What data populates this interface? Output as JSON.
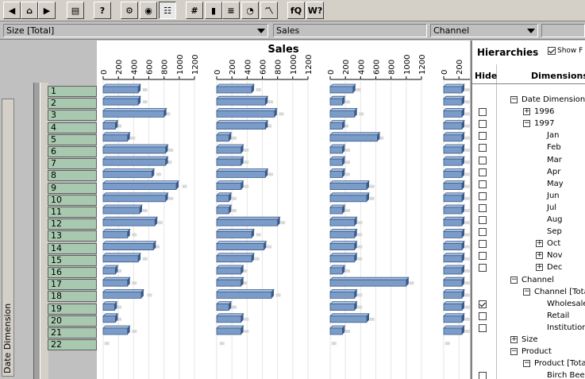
{
  "toolbar": {
    "buttons": [
      {
        "name": "back-arrow-icon",
        "glyph": "◀"
      },
      {
        "name": "home-icon",
        "glyph": "⌂"
      },
      {
        "name": "forward-arrow-icon",
        "glyph": "▶"
      },
      {
        "name": "report-icon",
        "glyph": "▤"
      },
      {
        "name": "query-icon",
        "glyph": "?"
      },
      {
        "name": "chart-wizard-icon",
        "glyph": "⚙"
      },
      {
        "name": "palette-icon",
        "glyph": "◉"
      },
      {
        "name": "hierarchy-icon",
        "glyph": "☷"
      },
      {
        "name": "number-format-icon",
        "glyph": "#"
      },
      {
        "name": "vertical-bar-chart-icon",
        "glyph": "▮"
      },
      {
        "name": "horizontal-bar-chart-icon",
        "glyph": "≡"
      },
      {
        "name": "pie-chart-icon",
        "glyph": "◔"
      },
      {
        "name": "line-chart-icon",
        "glyph": "〽"
      },
      {
        "name": "formula-icon",
        "glyph": "fQ"
      },
      {
        "name": "help-icon",
        "glyph": "W?"
      }
    ]
  },
  "dropdowns": {
    "size": "Size [Total]",
    "measure": "Sales",
    "channel": "Channel"
  },
  "row_dimension": "Date Dimension",
  "row_labels": [
    "1",
    "2",
    "3",
    "4",
    "5",
    "6",
    "7",
    "8",
    "9",
    "10",
    "11",
    "12",
    "13",
    "14",
    "15",
    "16",
    "17",
    "18",
    "19",
    "20",
    "21",
    "22"
  ],
  "hierarchies": {
    "title": "Hierarchies",
    "show_label": "Show F",
    "show_checked": true,
    "col_hide": "Hide",
    "col_dimensions": "Dimensions",
    "items": [
      {
        "label": "Date Dimension",
        "toggle": "−",
        "level": 0,
        "checkbox": false
      },
      {
        "label": "1996",
        "toggle": "+",
        "level": 1,
        "checkbox": true,
        "checked": false
      },
      {
        "label": "1997",
        "toggle": "−",
        "level": 1,
        "checkbox": true,
        "checked": false
      },
      {
        "label": "Jan",
        "toggle": "",
        "level": 2,
        "checkbox": true,
        "checked": false
      },
      {
        "label": "Feb",
        "toggle": "",
        "level": 2,
        "checkbox": true,
        "checked": false
      },
      {
        "label": "Mar",
        "toggle": "",
        "level": 2,
        "checkbox": true,
        "checked": false
      },
      {
        "label": "Apr",
        "toggle": "",
        "level": 2,
        "checkbox": true,
        "checked": false
      },
      {
        "label": "May",
        "toggle": "",
        "level": 2,
        "checkbox": true,
        "checked": false
      },
      {
        "label": "Jun",
        "toggle": "",
        "level": 2,
        "checkbox": true,
        "checked": false
      },
      {
        "label": "Jul",
        "toggle": "",
        "level": 2,
        "checkbox": true,
        "checked": false
      },
      {
        "label": "Aug",
        "toggle": "",
        "level": 2,
        "checkbox": true,
        "checked": false
      },
      {
        "label": "Sep",
        "toggle": "",
        "level": 2,
        "checkbox": true,
        "checked": false
      },
      {
        "label": "Oct",
        "toggle": "+",
        "level": 2,
        "checkbox": true,
        "checked": false
      },
      {
        "label": "Nov",
        "toggle": "+",
        "level": 2,
        "checkbox": true,
        "checked": false
      },
      {
        "label": "Dec",
        "toggle": "+",
        "level": 2,
        "checkbox": true,
        "checked": false
      },
      {
        "label": "Channel",
        "toggle": "−",
        "level": 0,
        "checkbox": false
      },
      {
        "label": "Channel [Tota",
        "toggle": "−",
        "level": 1,
        "checkbox": false
      },
      {
        "label": "Wholesale",
        "toggle": "",
        "level": 2,
        "checkbox": true,
        "checked": true
      },
      {
        "label": "Retail",
        "toggle": "",
        "level": 2,
        "checkbox": true,
        "checked": false
      },
      {
        "label": "Institution",
        "toggle": "",
        "level": 2,
        "checkbox": true,
        "checked": false
      },
      {
        "label": "Size",
        "toggle": "+",
        "level": 0,
        "checkbox": false
      },
      {
        "label": "Product",
        "toggle": "−",
        "level": 0,
        "checkbox": false
      },
      {
        "label": "Product [Tota",
        "toggle": "−",
        "level": 1,
        "checkbox": false
      },
      {
        "label": "Birch Beer",
        "toggle": "",
        "level": 2,
        "checkbox": true,
        "checked": false
      }
    ]
  },
  "colors": {
    "bar": "#7b9cc8",
    "bar_dark": "#3a5a8a",
    "bar_light": "#a9c1e0",
    "ghost": "#d8d8d8",
    "row_cell": "#a8c8b0"
  },
  "chart_data": {
    "type": "bar",
    "orientation": "horizontal",
    "title": "Sales",
    "categories": [
      "1",
      "2",
      "3",
      "4",
      "5",
      "6",
      "7",
      "8",
      "9",
      "10",
      "11",
      "12",
      "13",
      "14",
      "15",
      "16",
      "17",
      "18",
      "19",
      "20",
      "21",
      "22"
    ],
    "ticks": [
      "0",
      "200",
      "400",
      "600",
      "800",
      "1000",
      "1200"
    ],
    "xlim": [
      0,
      1200
    ],
    "series": [
      {
        "values": [
          460,
          460,
          800,
          160,
          320,
          820,
          820,
          640,
          960,
          820,
          480,
          680,
          320,
          660,
          460,
          160,
          320,
          500,
          150,
          160,
          320,
          null
        ]
      },
      {
        "values": [
          460,
          640,
          760,
          640,
          160,
          320,
          320,
          640,
          320,
          160,
          160,
          800,
          460,
          620,
          460,
          320,
          320,
          720,
          160,
          320,
          320,
          null
        ]
      },
      {
        "values": [
          300,
          160,
          320,
          160,
          620,
          160,
          160,
          160,
          480,
          480,
          160,
          320,
          320,
          320,
          320,
          160,
          1000,
          320,
          320,
          480,
          160,
          null
        ]
      },
      {
        "values": [
          240,
          240,
          240,
          240,
          240,
          240,
          240,
          240,
          240,
          240,
          240,
          240,
          240,
          240,
          240,
          240,
          240,
          240,
          240,
          240,
          240,
          null
        ]
      }
    ],
    "ghost_series": [
      {
        "values": [
          560,
          560,
          860,
          220,
          400,
          900,
          880,
          740,
          1080,
          900,
          560,
          760,
          420,
          720,
          560,
          220,
          420,
          620,
          220,
          220,
          420,
          60
        ]
      },
      {
        "values": [
          560,
          720,
          860,
          700,
          240,
          400,
          400,
          720,
          400,
          240,
          240,
          880,
          560,
          700,
          540,
          380,
          380,
          820,
          240,
          400,
          400,
          80
        ]
      },
      {
        "values": [
          380,
          240,
          420,
          220,
          680,
          240,
          240,
          240,
          560,
          560,
          240,
          400,
          400,
          400,
          400,
          240,
          1080,
          400,
          400,
          560,
          240,
          60
        ]
      },
      {
        "values": [
          320,
          320,
          320,
          320,
          320,
          320,
          320,
          320,
          320,
          320,
          320,
          320,
          320,
          320,
          320,
          320,
          320,
          320,
          320,
          320,
          320,
          60
        ]
      }
    ]
  }
}
